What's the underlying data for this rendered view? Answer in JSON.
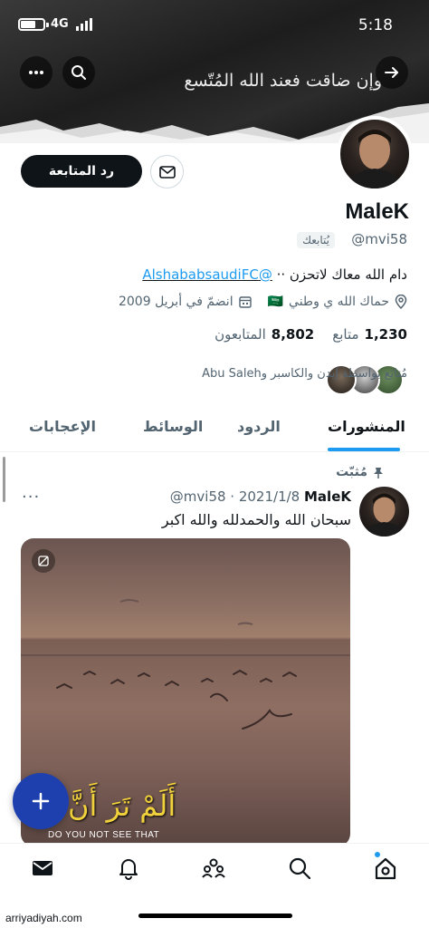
{
  "status_bar": {
    "time": "5:18",
    "network": "4G"
  },
  "banner": {
    "text": "وإن ضاقت فعند الله المُتّسع"
  },
  "profile": {
    "follow_back_label": "رد المتابعة",
    "display_name": "MaleK",
    "handle": "@mvi58",
    "follows_you": "يُتابعك",
    "bio_text": "دام الله معاك لاتحزن ··",
    "bio_mention": "@AlshababsaudiFC",
    "location": "حماك الله ي وطني",
    "flag": "🇸🇦",
    "joined": "انضمّ في أبريل 2009",
    "following_count": "1,230",
    "following_label": "متابع",
    "followers_count": "8,802",
    "followers_label": "المتابعون",
    "followed_by": "مُتابَع بواسطة إيدن والكاسبر وAbu Saleh"
  },
  "tabs": [
    {
      "label": "المنشورات",
      "active": true
    },
    {
      "label": "الردود",
      "active": false
    },
    {
      "label": "الوسائط",
      "active": false
    },
    {
      "label": "الإعجابات",
      "active": false
    }
  ],
  "post": {
    "pinned_label": "مُثبّت",
    "name": "MaleK",
    "handle_date": "@mvi58 · 2021/1/8",
    "text": "سبحان الله والحمدلله والله اكبر",
    "more": "···",
    "media_caption": "أَلَمْ تَرَ أَنَّ",
    "media_subtitle": "DO YOU NOT SEE THAT"
  },
  "watermark": "arriyadiyah.com",
  "colors": {
    "accent": "#1d9bf0",
    "fab": "#1e40af",
    "text": "#0f1419",
    "secondary": "#536471"
  }
}
